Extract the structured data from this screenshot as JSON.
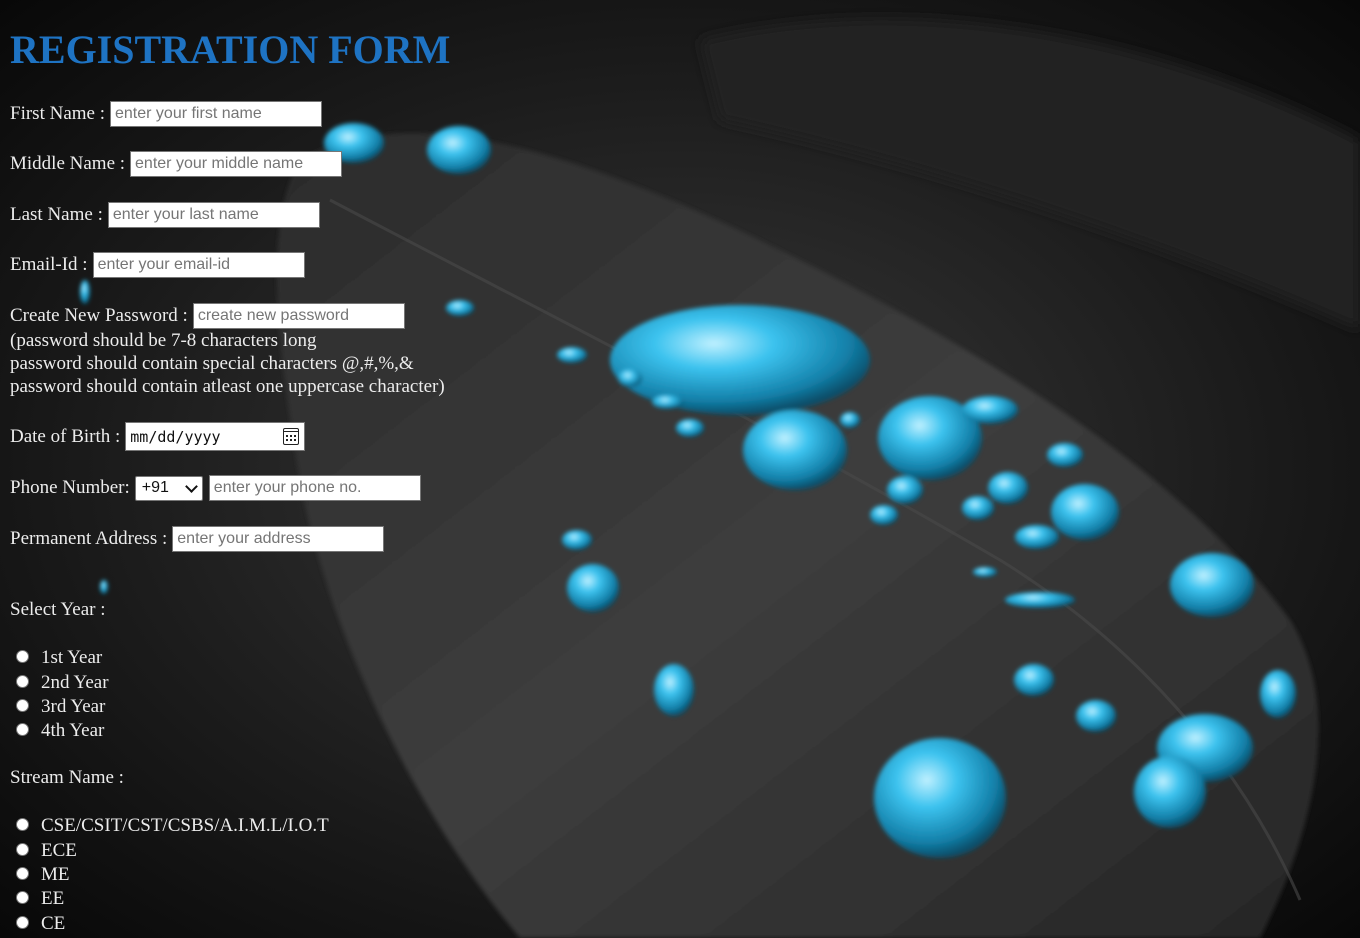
{
  "form": {
    "title": "REGISTRATION FORM",
    "first_name": {
      "label": "First Name :",
      "placeholder": "enter your first name"
    },
    "middle_name": {
      "label": "Middle Name :",
      "placeholder": "enter your middle name"
    },
    "last_name": {
      "label": "Last Name :",
      "placeholder": "enter your last name"
    },
    "email": {
      "label": "Email-Id :",
      "placeholder": "enter your email-id"
    },
    "password": {
      "label": "Create New Password :",
      "placeholder": "create new password",
      "hints": [
        "(password should be 7-8 characters long",
        "password should contain special characters @,#,%,&",
        "password should contain atleast one uppercase character)"
      ]
    },
    "dob": {
      "label": "Date of Birth :",
      "value": "mm/dd/yyyy",
      "icon": "calendar-icon"
    },
    "phone": {
      "label": "Phone Number:",
      "code": "+91",
      "placeholder": "enter your phone no."
    },
    "address": {
      "label": "Permanent Address :",
      "placeholder": "enter your address"
    },
    "year": {
      "label": "Select Year :",
      "options": [
        "1st Year",
        "2nd Year",
        "3rd Year",
        "4th Year"
      ]
    },
    "stream": {
      "label": "Stream Name :",
      "options": [
        "CSE/CSIT/CST/CSBS/A.I.M.L/I.O.T",
        "ECE",
        "ME",
        "EE",
        "CE"
      ]
    }
  },
  "colors": {
    "title": "#1e73c3",
    "text": "#ececec",
    "droplet": "#2fb8e6",
    "background": "#0b0b0b"
  }
}
